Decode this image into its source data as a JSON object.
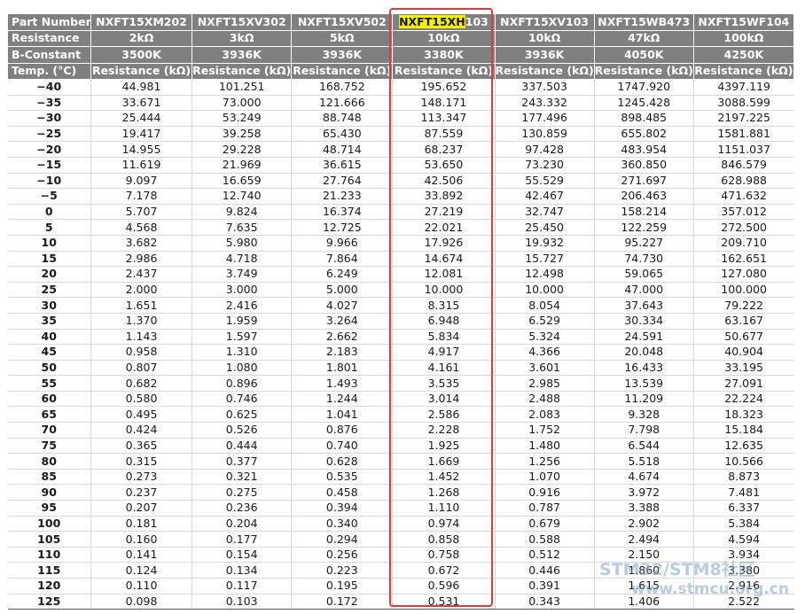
{
  "table": {
    "row_labels": {
      "part_number": "Part Number",
      "resistance": "Resistance",
      "b_constant": "B-Constant",
      "temp": "Temp. (°C)"
    },
    "parts": [
      {
        "pre": "NXFT15XM202",
        "hl": "",
        "post": "",
        "resistance": "2kΩ",
        "b_constant": "3500K",
        "unit": "Resistance (kΩ)"
      },
      {
        "pre": "NXFT15XV302",
        "hl": "",
        "post": "",
        "resistance": "3kΩ",
        "b_constant": "3936K",
        "unit": "Resistance (kΩ)"
      },
      {
        "pre": "NXFT15XV502",
        "hl": "",
        "post": "",
        "resistance": "5kΩ",
        "b_constant": "3936K",
        "unit": "Resistance (kΩ)"
      },
      {
        "pre": "",
        "hl": "NXFT15XH",
        "post": "103",
        "resistance": "10kΩ",
        "b_constant": "3380K",
        "unit": "Resistance (kΩ)"
      },
      {
        "pre": "NXFT15XV103",
        "hl": "",
        "post": "",
        "resistance": "10kΩ",
        "b_constant": "3936K",
        "unit": "Resistance (kΩ)"
      },
      {
        "pre": "NXFT15WB473",
        "hl": "",
        "post": "",
        "resistance": "47kΩ",
        "b_constant": "4050K",
        "unit": "Resistance (kΩ)"
      },
      {
        "pre": "NXFT15WF104",
        "hl": "",
        "post": "",
        "resistance": "100kΩ",
        "b_constant": "4250K",
        "unit": "Resistance (kΩ)"
      }
    ],
    "rows": [
      [
        "−40",
        "44.981",
        "101.251",
        "168.752",
        "195.652",
        "337.503",
        "1747.920",
        "4397.119"
      ],
      [
        "−35",
        "33.671",
        "73.000",
        "121.666",
        "148.171",
        "243.332",
        "1245.428",
        "3088.599"
      ],
      [
        "−30",
        "25.444",
        "53.249",
        "88.748",
        "113.347",
        "177.496",
        "898.485",
        "2197.225"
      ],
      [
        "−25",
        "19.417",
        "39.258",
        "65.430",
        "87.559",
        "130.859",
        "655.802",
        "1581.881"
      ],
      [
        "−20",
        "14.955",
        "29.228",
        "48.714",
        "68.237",
        "97.428",
        "483.954",
        "1151.037"
      ],
      [
        "−15",
        "11.619",
        "21.969",
        "36.615",
        "53.650",
        "73.230",
        "360.850",
        "846.579"
      ],
      [
        "−10",
        "9.097",
        "16.659",
        "27.764",
        "42.506",
        "55.529",
        "271.697",
        "628.988"
      ],
      [
        "−5",
        "7.178",
        "12.740",
        "21.233",
        "33.892",
        "42.467",
        "206.463",
        "471.632"
      ],
      [
        "0",
        "5.707",
        "9.824",
        "16.374",
        "27.219",
        "32.747",
        "158.214",
        "357.012"
      ],
      [
        "5",
        "4.568",
        "7.635",
        "12.725",
        "22.021",
        "25.450",
        "122.259",
        "272.500"
      ],
      [
        "10",
        "3.682",
        "5.980",
        "9.966",
        "17.926",
        "19.932",
        "95.227",
        "209.710"
      ],
      [
        "15",
        "2.986",
        "4.718",
        "7.864",
        "14.674",
        "15.727",
        "74.730",
        "162.651"
      ],
      [
        "20",
        "2.437",
        "3.749",
        "6.249",
        "12.081",
        "12.498",
        "59.065",
        "127.080"
      ],
      [
        "25",
        "2.000",
        "3.000",
        "5.000",
        "10.000",
        "10.000",
        "47.000",
        "100.000"
      ],
      [
        "30",
        "1.651",
        "2.416",
        "4.027",
        "8.315",
        "8.054",
        "37.643",
        "79.222"
      ],
      [
        "35",
        "1.370",
        "1.959",
        "3.264",
        "6.948",
        "6.529",
        "30.334",
        "63.167"
      ],
      [
        "40",
        "1.143",
        "1.597",
        "2.662",
        "5.834",
        "5.324",
        "24.591",
        "50.677"
      ],
      [
        "45",
        "0.958",
        "1.310",
        "2.183",
        "4.917",
        "4.366",
        "20.048",
        "40.904"
      ],
      [
        "50",
        "0.807",
        "1.080",
        "1.801",
        "4.161",
        "3.601",
        "16.433",
        "33.195"
      ],
      [
        "55",
        "0.682",
        "0.896",
        "1.493",
        "3.535",
        "2.985",
        "13.539",
        "27.091"
      ],
      [
        "60",
        "0.580",
        "0.746",
        "1.244",
        "3.014",
        "2.488",
        "11.209",
        "22.224"
      ],
      [
        "65",
        "0.495",
        "0.625",
        "1.041",
        "2.586",
        "2.083",
        "9.328",
        "18.323"
      ],
      [
        "70",
        "0.424",
        "0.526",
        "0.876",
        "2.228",
        "1.752",
        "7.798",
        "15.184"
      ],
      [
        "75",
        "0.365",
        "0.444",
        "0.740",
        "1.925",
        "1.480",
        "6.544",
        "12.635"
      ],
      [
        "80",
        "0.315",
        "0.377",
        "0.628",
        "1.669",
        "1.256",
        "5.518",
        "10.566"
      ],
      [
        "85",
        "0.273",
        "0.321",
        "0.535",
        "1.452",
        "1.070",
        "4.674",
        "8.873"
      ],
      [
        "90",
        "0.237",
        "0.275",
        "0.458",
        "1.268",
        "0.916",
        "3.972",
        "7.481"
      ],
      [
        "95",
        "0.207",
        "0.236",
        "0.394",
        "1.110",
        "0.787",
        "3.388",
        "6.337"
      ],
      [
        "100",
        "0.181",
        "0.204",
        "0.340",
        "0.974",
        "0.679",
        "2.902",
        "5.384"
      ],
      [
        "105",
        "0.160",
        "0.177",
        "0.294",
        "0.858",
        "0.588",
        "2.494",
        "4.594"
      ],
      [
        "110",
        "0.141",
        "0.154",
        "0.256",
        "0.758",
        "0.512",
        "2.150",
        "3.934"
      ],
      [
        "115",
        "0.124",
        "0.134",
        "0.223",
        "0.672",
        "0.446",
        "1.860",
        "3.380"
      ],
      [
        "120",
        "0.110",
        "0.117",
        "0.195",
        "0.596",
        "0.391",
        "1.615",
        "2.916"
      ],
      [
        "125",
        "0.098",
        "0.103",
        "0.172",
        "0.531",
        "0.343",
        "1.406",
        "2.522"
      ]
    ]
  },
  "highlight": {
    "highlighted_column": "NXFT15XH103",
    "box_color": "#e53935",
    "text_highlight_color": "#f4f000"
  },
  "watermark": {
    "line1": "STM32/STM8社区",
    "line2": "www.stmcu.org.cn"
  },
  "colors": {
    "header_bg": "#808080",
    "header_text": "#ffffff",
    "body_text": "#1a1a1a",
    "watermark": "#7da4c8"
  }
}
